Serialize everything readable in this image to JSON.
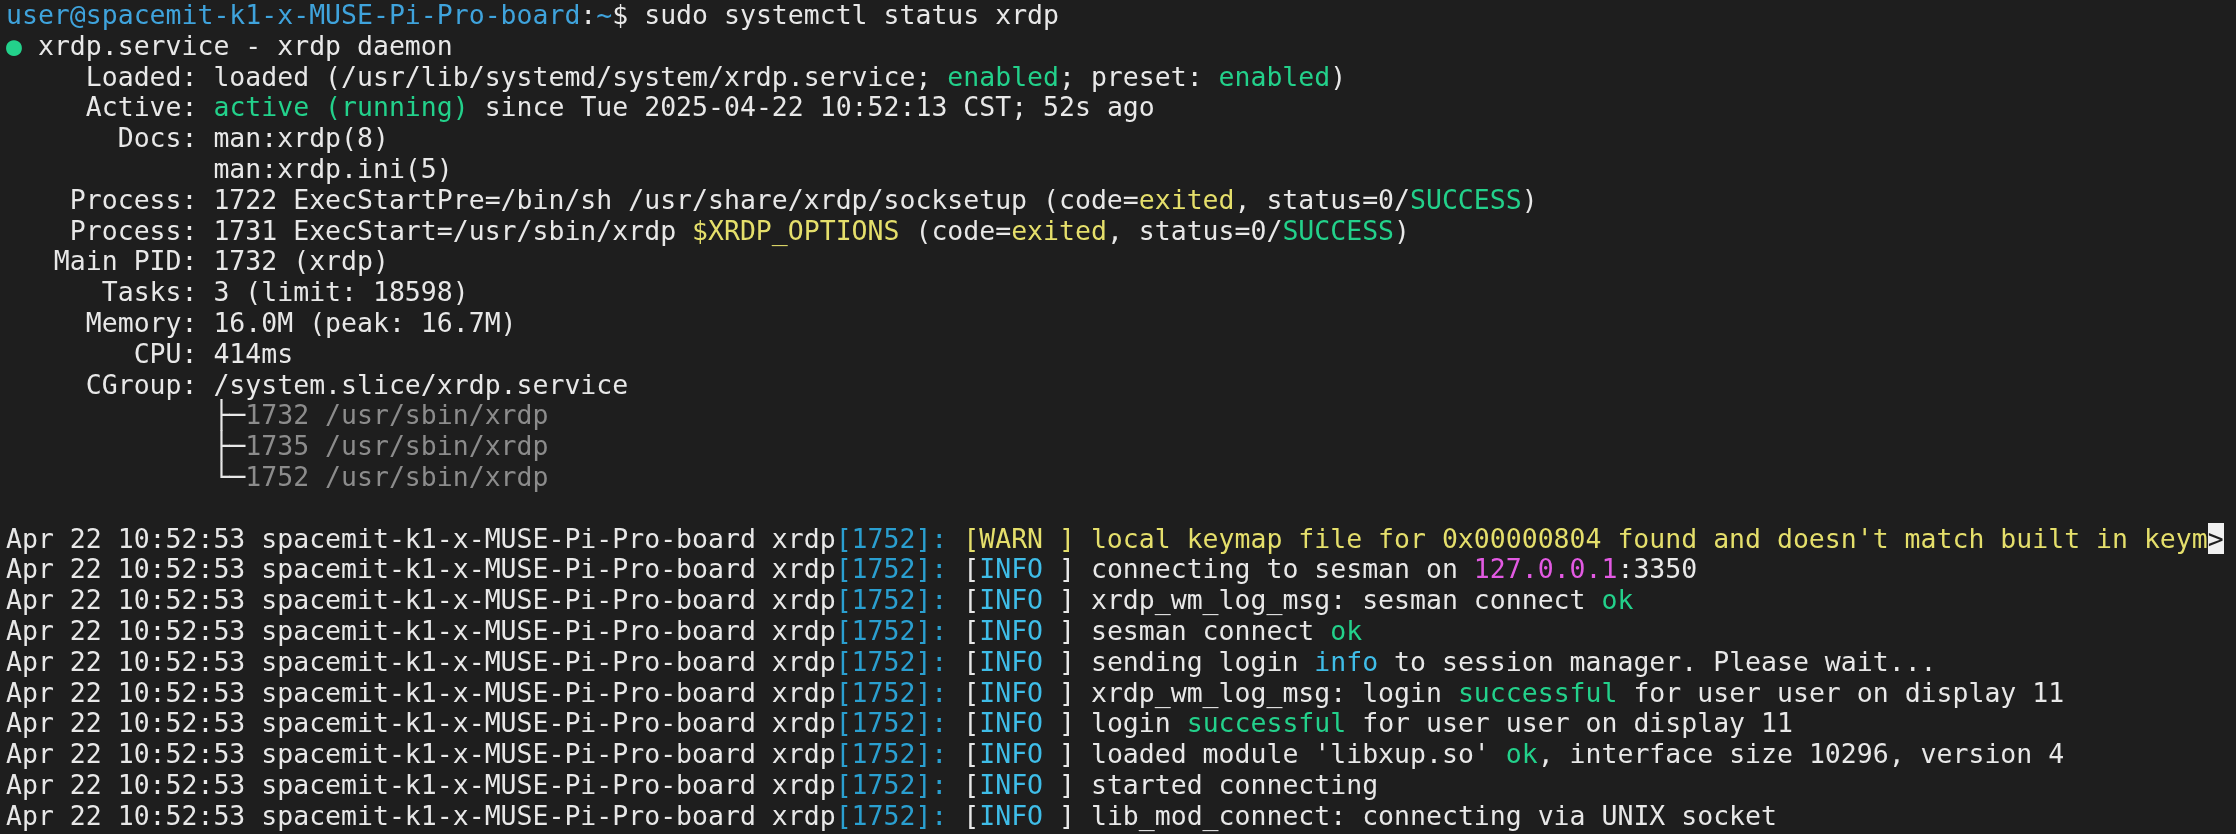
{
  "status_lines": [
    {
      "segments": [
        {
          "text": "user@spacemit-k1-x-MUSE-Pi-Pro-board",
          "kind": "host"
        },
        {
          "text": ":",
          "kind": "plain"
        },
        {
          "text": "~",
          "kind": "host"
        },
        {
          "text": "$ sudo systemctl status xrdp",
          "kind": "plain"
        }
      ]
    },
    {
      "segments": [
        {
          "text": "●",
          "kind": "green"
        },
        {
          "text": " xrdp.service - xrdp daemon",
          "kind": "plain"
        }
      ]
    },
    {
      "segments": [
        {
          "text": "     Loaded: loaded (/usr/lib/systemd/system/xrdp.service; ",
          "kind": "plain"
        },
        {
          "text": "enabled",
          "kind": "green"
        },
        {
          "text": "; preset: ",
          "kind": "plain"
        },
        {
          "text": "enabled",
          "kind": "green"
        },
        {
          "text": ")",
          "kind": "plain"
        }
      ]
    },
    {
      "segments": [
        {
          "text": "     Active: ",
          "kind": "plain"
        },
        {
          "text": "active (running)",
          "kind": "green"
        },
        {
          "text": " since Tue 2025-04-22 10:52:13 CST; 52s ago",
          "kind": "plain"
        }
      ]
    },
    {
      "segments": [
        {
          "text": "       Docs: man:xrdp(8)",
          "kind": "plain"
        }
      ]
    },
    {
      "segments": [
        {
          "text": "             man:xrdp.ini(5)",
          "kind": "plain"
        }
      ]
    },
    {
      "segments": [
        {
          "text": "    Process: 1722 ExecStartPre=/bin/sh /usr/share/xrdp/socksetup (code=",
          "kind": "plain"
        },
        {
          "text": "exited",
          "kind": "yellow"
        },
        {
          "text": ", status=0/",
          "kind": "plain"
        },
        {
          "text": "SUCCESS",
          "kind": "green"
        },
        {
          "text": ")",
          "kind": "plain"
        }
      ]
    },
    {
      "segments": [
        {
          "text": "    Process: 1731 ExecStart=/usr/sbin/xrdp ",
          "kind": "plain"
        },
        {
          "text": "$XRDP_OPTIONS",
          "kind": "yellow"
        },
        {
          "text": " (code=",
          "kind": "plain"
        },
        {
          "text": "exited",
          "kind": "yellow"
        },
        {
          "text": ", status=0/",
          "kind": "plain"
        },
        {
          "text": "SUCCESS",
          "kind": "green"
        },
        {
          "text": ")",
          "kind": "plain"
        }
      ]
    },
    {
      "segments": [
        {
          "text": "   Main PID: 1732 (xrdp)",
          "kind": "plain"
        }
      ]
    },
    {
      "segments": [
        {
          "text": "      Tasks: 3 (limit: 18598)",
          "kind": "plain"
        }
      ]
    },
    {
      "segments": [
        {
          "text": "     Memory: 16.0M (peak: 16.7M)",
          "kind": "plain"
        }
      ]
    },
    {
      "segments": [
        {
          "text": "        CPU: 414ms",
          "kind": "plain"
        }
      ]
    },
    {
      "segments": [
        {
          "text": "     CGroup: /system.slice/xrdp.service",
          "kind": "plain"
        }
      ]
    },
    {
      "segments": [
        {
          "text": "             ├─",
          "kind": "plain"
        },
        {
          "text": "1732 /usr/sbin/xrdp",
          "kind": "dim"
        }
      ]
    },
    {
      "segments": [
        {
          "text": "             ├─",
          "kind": "plain"
        },
        {
          "text": "1735 /usr/sbin/xrdp",
          "kind": "dim"
        }
      ]
    },
    {
      "segments": [
        {
          "text": "             └─",
          "kind": "plain"
        },
        {
          "text": "1752 /usr/sbin/xrdp",
          "kind": "dim"
        }
      ]
    }
  ],
  "journal_lines": [
    {
      "segments": [
        {
          "text": "Apr 22 10:52:53 spacemit-k1-x-MUSE-Pi-Pro-board xrdp",
          "kind": "plain"
        },
        {
          "text": "[1752]:",
          "kind": "pid"
        },
        {
          "text": " [WARN ] local keymap file for 0x00000804 found and doesn't match built in keym",
          "kind": "yellow"
        },
        {
          "text": ">",
          "kind": "inverse"
        }
      ]
    },
    {
      "segments": [
        {
          "text": "Apr 22 10:52:53 spacemit-k1-x-MUSE-Pi-Pro-board xrdp",
          "kind": "plain"
        },
        {
          "text": "[1752]:",
          "kind": "pid"
        },
        {
          "text": " [",
          "kind": "plain"
        },
        {
          "text": "INFO",
          "kind": "info"
        },
        {
          "text": " ] connecting to sesman on ",
          "kind": "plain"
        },
        {
          "text": "127.0.0.1",
          "kind": "magenta"
        },
        {
          "text": ":3350",
          "kind": "plain"
        }
      ]
    },
    {
      "segments": [
        {
          "text": "Apr 22 10:52:53 spacemit-k1-x-MUSE-Pi-Pro-board xrdp",
          "kind": "plain"
        },
        {
          "text": "[1752]:",
          "kind": "pid"
        },
        {
          "text": " [",
          "kind": "plain"
        },
        {
          "text": "INFO",
          "kind": "info"
        },
        {
          "text": " ] xrdp_wm_log_msg: sesman connect ",
          "kind": "plain"
        },
        {
          "text": "ok",
          "kind": "green"
        }
      ]
    },
    {
      "segments": [
        {
          "text": "Apr 22 10:52:53 spacemit-k1-x-MUSE-Pi-Pro-board xrdp",
          "kind": "plain"
        },
        {
          "text": "[1752]:",
          "kind": "pid"
        },
        {
          "text": " [",
          "kind": "plain"
        },
        {
          "text": "INFO",
          "kind": "info"
        },
        {
          "text": " ] sesman connect ",
          "kind": "plain"
        },
        {
          "text": "ok",
          "kind": "green"
        }
      ]
    },
    {
      "segments": [
        {
          "text": "Apr 22 10:52:53 spacemit-k1-x-MUSE-Pi-Pro-board xrdp",
          "kind": "plain"
        },
        {
          "text": "[1752]:",
          "kind": "pid"
        },
        {
          "text": " [",
          "kind": "plain"
        },
        {
          "text": "INFO",
          "kind": "info"
        },
        {
          "text": " ] sending login ",
          "kind": "plain"
        },
        {
          "text": "info",
          "kind": "info"
        },
        {
          "text": " to session manager. Please wait...",
          "kind": "plain"
        }
      ]
    },
    {
      "segments": [
        {
          "text": "Apr 22 10:52:53 spacemit-k1-x-MUSE-Pi-Pro-board xrdp",
          "kind": "plain"
        },
        {
          "text": "[1752]:",
          "kind": "pid"
        },
        {
          "text": " [",
          "kind": "plain"
        },
        {
          "text": "INFO",
          "kind": "info"
        },
        {
          "text": " ] xrdp_wm_log_msg: login ",
          "kind": "plain"
        },
        {
          "text": "successful",
          "kind": "green"
        },
        {
          "text": " for user user on display 11",
          "kind": "plain"
        }
      ]
    },
    {
      "segments": [
        {
          "text": "Apr 22 10:52:53 spacemit-k1-x-MUSE-Pi-Pro-board xrdp",
          "kind": "plain"
        },
        {
          "text": "[1752]:",
          "kind": "pid"
        },
        {
          "text": " [",
          "kind": "plain"
        },
        {
          "text": "INFO",
          "kind": "info"
        },
        {
          "text": " ] login ",
          "kind": "plain"
        },
        {
          "text": "successful",
          "kind": "green"
        },
        {
          "text": " for user user on display 11",
          "kind": "plain"
        }
      ]
    },
    {
      "segments": [
        {
          "text": "Apr 22 10:52:53 spacemit-k1-x-MUSE-Pi-Pro-board xrdp",
          "kind": "plain"
        },
        {
          "text": "[1752]:",
          "kind": "pid"
        },
        {
          "text": " [",
          "kind": "plain"
        },
        {
          "text": "INFO",
          "kind": "info"
        },
        {
          "text": " ] loaded module 'libxup.so' ",
          "kind": "plain"
        },
        {
          "text": "ok",
          "kind": "green"
        },
        {
          "text": ", interface size 10296, version 4",
          "kind": "plain"
        }
      ]
    },
    {
      "segments": [
        {
          "text": "Apr 22 10:52:53 spacemit-k1-x-MUSE-Pi-Pro-board xrdp",
          "kind": "plain"
        },
        {
          "text": "[1752]:",
          "kind": "pid"
        },
        {
          "text": " [",
          "kind": "plain"
        },
        {
          "text": "INFO",
          "kind": "info"
        },
        {
          "text": " ] started connecting",
          "kind": "plain"
        }
      ]
    },
    {
      "segments": [
        {
          "text": "Apr 22 10:52:53 spacemit-k1-x-MUSE-Pi-Pro-board xrdp",
          "kind": "plain"
        },
        {
          "text": "[1752]:",
          "kind": "pid"
        },
        {
          "text": " [",
          "kind": "plain"
        },
        {
          "text": "INFO",
          "kind": "info"
        },
        {
          "text": " ] lib_mod_connect: connecting via UNIX socket",
          "kind": "plain"
        }
      ]
    }
  ]
}
